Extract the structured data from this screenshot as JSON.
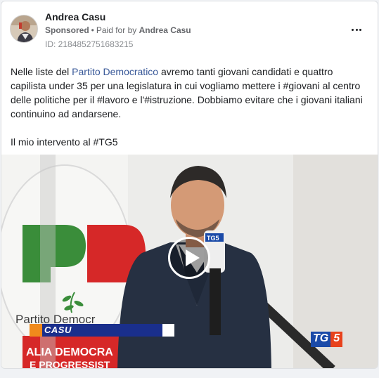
{
  "post": {
    "author": "Andrea Casu",
    "sponsored_label": "Sponsored",
    "paid_for_prefix": "Paid for by",
    "paid_for_name": "Andrea Casu",
    "ad_id": "ID: 2184852751683215",
    "more_icon": "more-horizontal-icon"
  },
  "body": {
    "text_a": "Nelle liste del ",
    "link": "Partito Democratico",
    "text_b": " avremo tanti giovani candidati e quattro capilista under 35 per una legislatura in cui vogliamo mettere i #giovani al centro delle politiche per il #lavoro e l'#istruzione. Dobbiamo evitare che i giovani italiani continuino ad andarsene.",
    "line2": "Il mio intervento al #TG5"
  },
  "video": {
    "caption_name": "CASU",
    "channel_tg": "TG",
    "channel_five": "5",
    "mic_logo": "TG5",
    "bg_logo_text": "Partito Democr",
    "bg_banner_1": "ALIA DEMOCRA",
    "bg_banner_2": "E PROGRESSIST",
    "play_icon": "play-icon"
  },
  "colors": {
    "link": "#385898",
    "pd_green": "#3a8d3a",
    "pd_red": "#d62828",
    "tg_blue": "#1a4aa8",
    "tg_orange": "#e8421c"
  }
}
